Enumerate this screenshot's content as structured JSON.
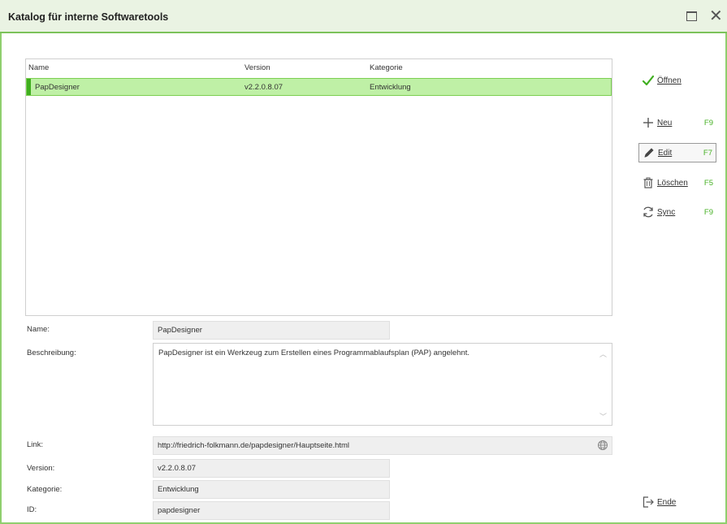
{
  "window": {
    "title": "Katalog für interne Softwaretools"
  },
  "table": {
    "columns": [
      "Name",
      "Version",
      "Kategorie"
    ],
    "rows": [
      {
        "name": "PapDesigner",
        "version": "v2.2.0.8.07",
        "category": "Entwicklung",
        "selected": true
      }
    ]
  },
  "detail": {
    "name_label": "Name:",
    "name_value": "PapDesigner",
    "description_label": "Beschreibung:",
    "description_value": "PapDesigner ist ein Werkzeug zum Erstellen eines Programmablaufsplan (PAP) angelehnt.",
    "link_label": "Link:",
    "link_value": "http://friedrich-folkmann.de/papdesigner/Hauptseite.html",
    "version_label": "Version:",
    "version_value": "v2.2.0.8.07",
    "category_label": "Kategorie:",
    "category_value": "Entwicklung",
    "id_label": "ID:",
    "id_value": "papdesigner"
  },
  "commands": {
    "open": {
      "label": "Öffnen",
      "icon": "checkmark-icon"
    },
    "new": {
      "label": "Neu",
      "key": "F9",
      "icon": "plus-icon"
    },
    "edit": {
      "label": "Edit",
      "key": "F7",
      "icon": "pencil-icon"
    },
    "delete": {
      "label": "Löschen",
      "key": "F5",
      "icon": "trash-icon"
    },
    "sync": {
      "label": "Sync",
      "key": "F9",
      "icon": "sync-icon"
    },
    "exit": {
      "label": "Ende",
      "icon": "exit-icon"
    }
  },
  "colors": {
    "accent_green": "#7cc25a",
    "selection_green": "#bff0a6",
    "shortcut_green": "#44b022",
    "titlebar_bg": "#eaf3e3"
  }
}
